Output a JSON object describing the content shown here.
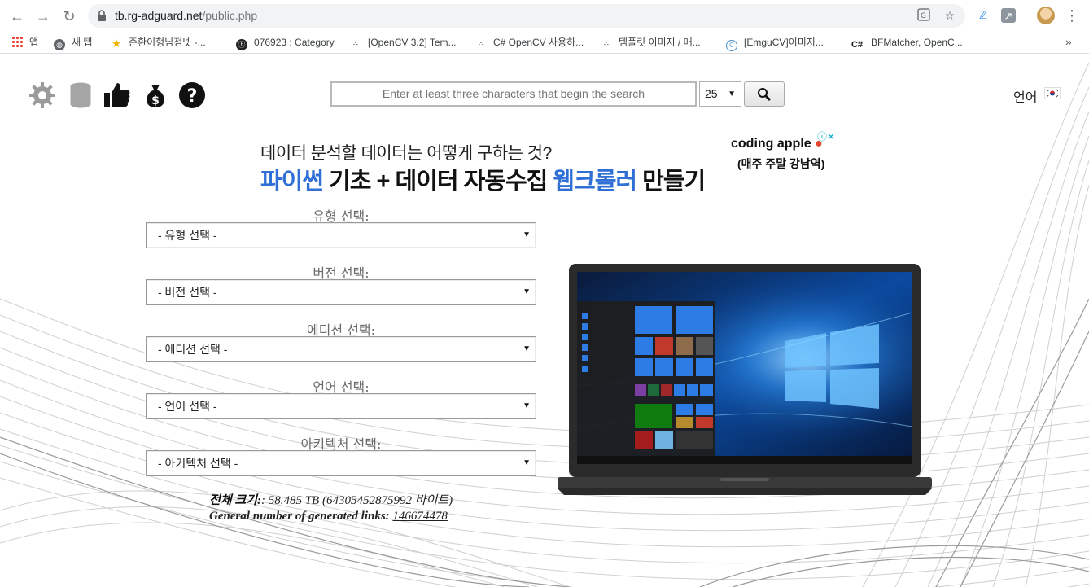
{
  "browser": {
    "url_host": "tb.rg-adguard.net",
    "url_path": "/public.php",
    "bookmarks": [
      {
        "label": "앱",
        "icon": "apps-grid-icon"
      },
      {
        "label": "새 탭",
        "icon": "globe-icon"
      },
      {
        "label": "준환이형님점넷 -...",
        "icon": "star-bookmark-icon"
      },
      {
        "label": "076923 : Category",
        "icon": "tistory-icon"
      },
      {
        "label": "[OpenCV 3.2] Tem...",
        "icon": "dots-icon"
      },
      {
        "label": "C# OpenCV 사용하...",
        "icon": "dots-icon"
      },
      {
        "label": "템플릿 이미지 / 매...",
        "icon": "dots-icon"
      },
      {
        "label": "[EmguCV]이미지...",
        "icon": "emgu-icon"
      },
      {
        "label": "BFMatcher, OpenC...",
        "icon": "csharp-icon"
      }
    ],
    "bookmarks_more": "»"
  },
  "toolbar": {
    "search_placeholder": "Enter at least three characters that begin the search",
    "count_value": "25",
    "language_label": "언어"
  },
  "ad": {
    "line1": "데이터 분석할 데이터는 어떻게 구하는 것?",
    "line2_a": "파이썬",
    "line2_b": " 기초 + 데이터 자동수집 ",
    "line2_c": "웹크롤러",
    "line2_d": " 만들기",
    "brand": "coding apple",
    "brand_sub": "(매주 주말 강남역)",
    "close": "ⓘ✕"
  },
  "form": {
    "type_label": "유형 선택:",
    "type_value": "- 유형 선택 -",
    "version_label": "버전 선택:",
    "version_value": "- 버전 선택 -",
    "edition_label": "에디션 선택:",
    "edition_value": "- 에디션 선택 -",
    "language_label": "언어 선택:",
    "language_value": "- 언어 선택 -",
    "arch_label": "아키텍처 선택:",
    "arch_value": "- 아키텍처 선택 -"
  },
  "stats": {
    "total_size_label": "전체 크기:",
    "total_size_value": ": 58.485 TB (64305452875992 바이트)",
    "links_label": "General number of generated links:",
    "links_value": "146674478"
  },
  "colors": {
    "ad_blue": "#2f6fd6",
    "apple_red": "#e8452c"
  }
}
